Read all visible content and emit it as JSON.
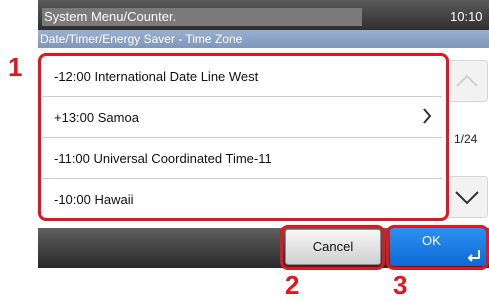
{
  "header": {
    "title": "System Menu/Counter.",
    "time": "10:10",
    "subtitle": "Date/Timer/Energy Saver - Time Zone"
  },
  "list": {
    "items": [
      {
        "label": "-12:00 International Date Line West",
        "has_submenu": false
      },
      {
        "label": "+13:00 Samoa",
        "has_submenu": true
      },
      {
        "label": "-11:00 Universal Coordinated Time-11",
        "has_submenu": false
      },
      {
        "label": "-10:00 Hawaii",
        "has_submenu": false
      }
    ],
    "page_indicator": "1/24"
  },
  "buttons": {
    "cancel": "Cancel",
    "ok": "OK"
  },
  "callouts": {
    "list": "1",
    "cancel": "2",
    "ok": "3"
  },
  "colors": {
    "callout": "#e2161e",
    "ok_button": "#1a7fe8",
    "subtitle_bar": "#8da4c6"
  }
}
